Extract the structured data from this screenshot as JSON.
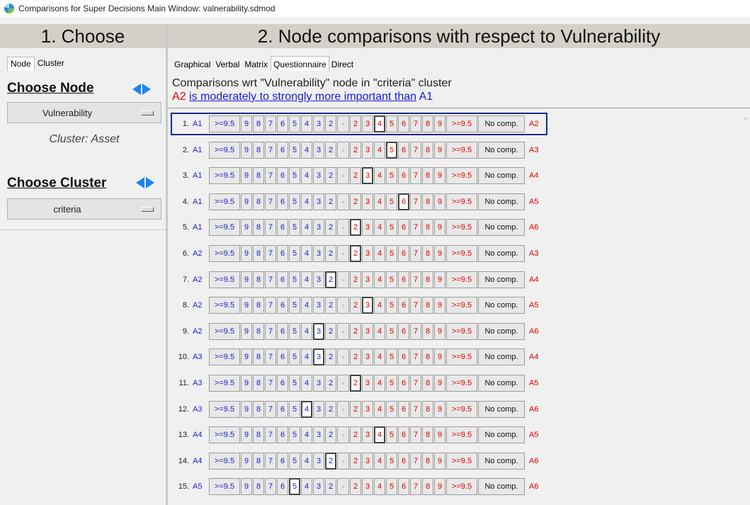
{
  "window": {
    "title": "Comparisons for Super Decisions Main Window: valnerability.sdmod"
  },
  "left": {
    "header": "1. Choose",
    "tabs": [
      "Node",
      "Cluster"
    ],
    "choose_node_title": "Choose Node",
    "node_dropdown_value": "Vulnerability",
    "cluster_caption": "Cluster: Asset",
    "choose_cluster_title": "Choose Cluster",
    "cluster_dropdown_value": "criteria"
  },
  "right": {
    "header": "2. Node comparisons with respect to Vulnerability",
    "tabs": [
      "Graphical",
      "Verbal",
      "Matrix",
      "Questionnaire",
      "Direct"
    ],
    "active_tab": "Questionnaire",
    "description_line1": "Comparisons wrt \"Vulnerability\" node in \"criteria\" cluster",
    "description_line2_left": "A2",
    "description_line2_phrase": "is moderately to strongly more important than",
    "description_line2_right": "A1"
  },
  "scale": {
    "left_labels": [
      ">=9.5",
      "9",
      "8",
      "7",
      "6",
      "5",
      "4",
      "3",
      "2"
    ],
    "right_labels": [
      "2",
      "3",
      "4",
      "5",
      "6",
      "7",
      "8",
      "9",
      ">=9.5"
    ],
    "no_comparison_label": "No comp."
  },
  "rows": [
    {
      "num": "1.",
      "left": "A1",
      "right": "A2",
      "side": "right",
      "value": "4",
      "selected": true
    },
    {
      "num": "2.",
      "left": "A1",
      "right": "A3",
      "side": "right",
      "value": "5"
    },
    {
      "num": "3.",
      "left": "A1",
      "right": "A4",
      "side": "right",
      "value": "3"
    },
    {
      "num": "4.",
      "left": "A1",
      "right": "A5",
      "side": "right",
      "value": "6"
    },
    {
      "num": "5.",
      "left": "A1",
      "right": "A6",
      "side": "right",
      "value": "2"
    },
    {
      "num": "6.",
      "left": "A2",
      "right": "A3",
      "side": "right",
      "value": "2"
    },
    {
      "num": "7.",
      "left": "A2",
      "right": "A4",
      "side": "left",
      "value": "2"
    },
    {
      "num": "8.",
      "left": "A2",
      "right": "A5",
      "side": "right",
      "value": "3"
    },
    {
      "num": "9.",
      "left": "A2",
      "right": "A6",
      "side": "left",
      "value": "3"
    },
    {
      "num": "10.",
      "left": "A3",
      "right": "A4",
      "side": "left",
      "value": "3"
    },
    {
      "num": "11.",
      "left": "A3",
      "right": "A5",
      "side": "right",
      "value": "2"
    },
    {
      "num": "12.",
      "left": "A3",
      "right": "A6",
      "side": "left",
      "value": "4"
    },
    {
      "num": "13.",
      "left": "A4",
      "right": "A5",
      "side": "right",
      "value": "4"
    },
    {
      "num": "14.",
      "left": "A4",
      "right": "A6",
      "side": "left",
      "value": "2"
    },
    {
      "num": "15.",
      "left": "A5",
      "right": "A6",
      "side": "left",
      "value": "5"
    }
  ],
  "colors": {
    "left_scale": "#1a1ad6",
    "right_scale": "#e00000",
    "selected_row_border": "#1b2a8e",
    "arrow": "#1b84f0"
  }
}
